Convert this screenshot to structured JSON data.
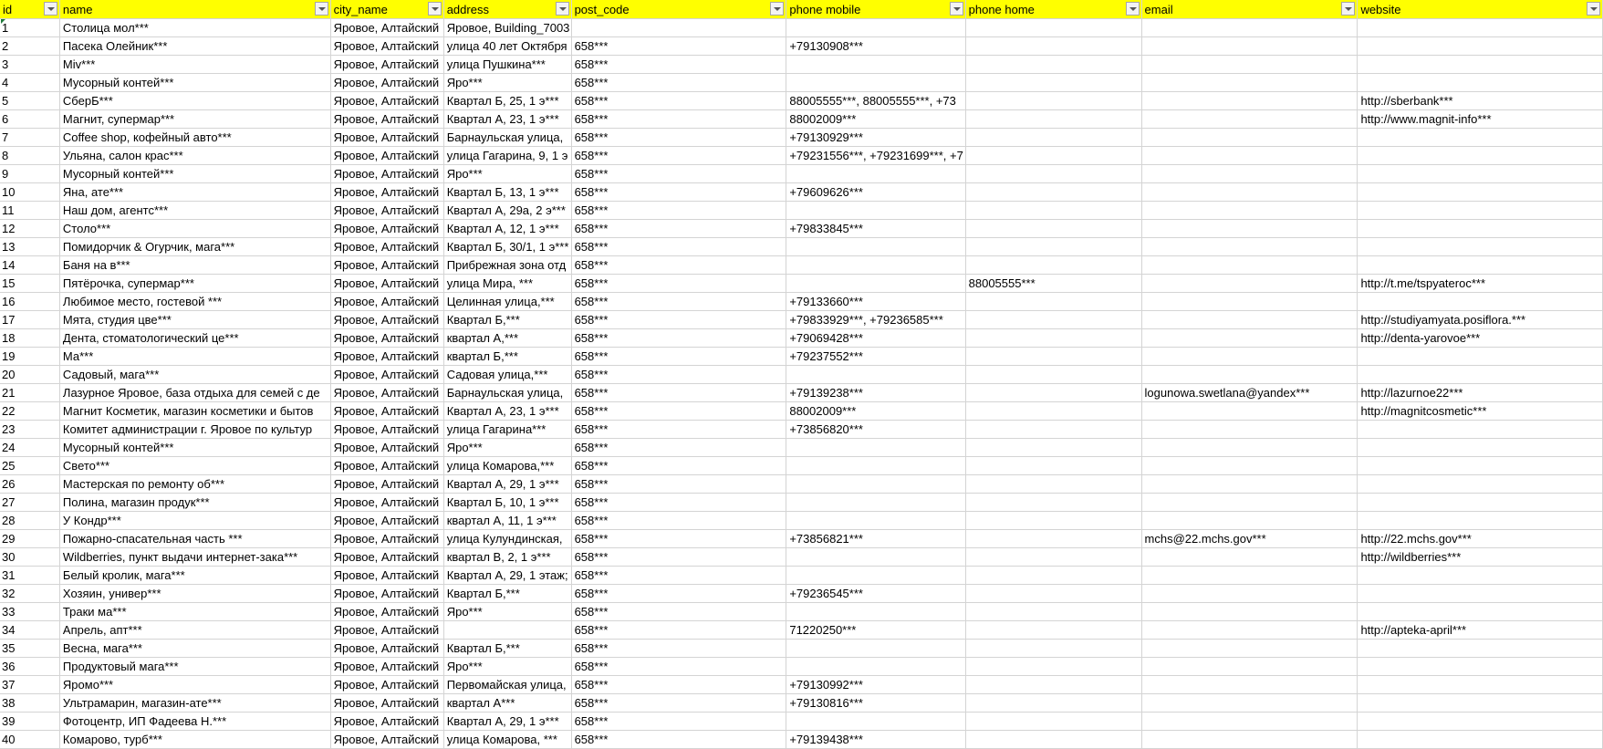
{
  "colors": {
    "header_bg": "#ffff00",
    "grid": "#d4d4d4",
    "active_marker": "#1f7a3a"
  },
  "columns": [
    "id",
    "name",
    "city_name",
    "address",
    "post_code",
    "phone mobile",
    "phone home",
    "email",
    "website"
  ],
  "rows": [
    [
      "1",
      "Столица мол***",
      "Яровое, Алтайский",
      "Яровое, Building_7003",
      "",
      "",
      "",
      "",
      ""
    ],
    [
      "2",
      "Пасека Олейник***",
      "Яровое, Алтайский",
      "улица 40 лет Октября",
      "658***",
      "+79130908***",
      "",
      "",
      ""
    ],
    [
      "3",
      "Miv***",
      "Яровое, Алтайский",
      "улица Пушкина***",
      "658***",
      "",
      "",
      "",
      ""
    ],
    [
      "4",
      "Мусорный контей***",
      "Яровое, Алтайский",
      "Яро***",
      "658***",
      "",
      "",
      "",
      ""
    ],
    [
      "5",
      "СберБ***",
      "Яровое, Алтайский",
      "Квартал Б, 25, 1 э***",
      "658***",
      "88005555***, 88005555***, +73",
      "",
      "",
      "http://sberbank***"
    ],
    [
      "6",
      "Магнит, супермар***",
      "Яровое, Алтайский",
      "Квартал А, 23, 1 э***",
      "658***",
      "88002009***",
      "",
      "",
      "http://www.magnit-info***"
    ],
    [
      "7",
      "Coffee shop, кофейный авто***",
      "Яровое, Алтайский",
      "Барнаульская улица,",
      "658***",
      "+79130929***",
      "",
      "",
      ""
    ],
    [
      "8",
      "Ульяна, салон крас***",
      "Яровое, Алтайский",
      "улица Гагарина, 9, 1 э",
      "658***",
      "+79231556***, +79231699***, +7",
      "",
      "",
      ""
    ],
    [
      "9",
      "Мусорный контей***",
      "Яровое, Алтайский",
      "Яро***",
      "658***",
      "",
      "",
      "",
      ""
    ],
    [
      "10",
      "Яна, ате***",
      "Яровое, Алтайский",
      "Квартал Б, 13, 1 э***",
      "658***",
      "+79609626***",
      "",
      "",
      ""
    ],
    [
      "11",
      "Наш дом, агентс***",
      "Яровое, Алтайский",
      "Квартал А, 29а, 2 э***",
      "658***",
      "",
      "",
      "",
      ""
    ],
    [
      "12",
      "Столо***",
      "Яровое, Алтайский",
      "Квартал А, 12, 1 э***",
      "658***",
      "+79833845***",
      "",
      "",
      ""
    ],
    [
      "13",
      "Помидорчик & Огурчик, мага***",
      "Яровое, Алтайский",
      "Квартал Б, 30/1, 1 э***",
      "658***",
      "",
      "",
      "",
      ""
    ],
    [
      "14",
      "Баня на в***",
      "Яровое, Алтайский",
      "Прибрежная зона отд",
      "658***",
      "",
      "",
      "",
      ""
    ],
    [
      "15",
      "Пятёрочка, супермар***",
      "Яровое, Алтайский",
      "улица Мира, ***",
      "658***",
      "",
      "88005555***",
      "",
      "http://t.me/tspyateroc***"
    ],
    [
      "16",
      "Любимое место, гостевой ***",
      "Яровое, Алтайский",
      "Целинная улица,***",
      "658***",
      "+79133660***",
      "",
      "",
      ""
    ],
    [
      "17",
      "Мята, студия цве***",
      "Яровое, Алтайский",
      "Квартал Б,***",
      "658***",
      "+79833929***, +79236585***",
      "",
      "",
      "http://studiyamyata.posiflora.***"
    ],
    [
      "18",
      "Дента, стоматологический це***",
      "Яровое, Алтайский",
      "квартал А,***",
      "658***",
      "+79069428***",
      "",
      "",
      "http://denta-yarovoe***"
    ],
    [
      "19",
      "Ма***",
      "Яровое, Алтайский",
      "квартал Б,***",
      "658***",
      "+79237552***",
      "",
      "",
      ""
    ],
    [
      "20",
      "Садовый, мага***",
      "Яровое, Алтайский",
      "Садовая улица,***",
      "658***",
      "",
      "",
      "",
      ""
    ],
    [
      "21",
      "Лазурное Яровое, база отдыха для семей с де",
      "Яровое, Алтайский",
      "Барнаульская улица,",
      "658***",
      "+79139238***",
      "",
      "logunowa.swetlana@yandex***",
      "http://lazurnoe22***"
    ],
    [
      "22",
      "Магнит Косметик, магазин косметики и бытов",
      "Яровое, Алтайский",
      "Квартал А, 23, 1 э***",
      "658***",
      "88002009***",
      "",
      "",
      "http://magnitcosmetic***"
    ],
    [
      "23",
      "Комитет администрации г. Яровое по культур",
      "Яровое, Алтайский",
      "улица Гагарина***",
      "658***",
      "+73856820***",
      "",
      "",
      ""
    ],
    [
      "24",
      "Мусорный контей***",
      "Яровое, Алтайский",
      "Яро***",
      "658***",
      "",
      "",
      "",
      ""
    ],
    [
      "25",
      "Свето***",
      "Яровое, Алтайский",
      "улица Комарова,***",
      "658***",
      "",
      "",
      "",
      ""
    ],
    [
      "26",
      "Мастерская по ремонту об***",
      "Яровое, Алтайский",
      "Квартал А, 29, 1 э***",
      "658***",
      "",
      "",
      "",
      ""
    ],
    [
      "27",
      "Полина, магазин продук***",
      "Яровое, Алтайский",
      "Квартал Б, 10, 1 э***",
      "658***",
      "",
      "",
      "",
      ""
    ],
    [
      "28",
      "У Кондр***",
      "Яровое, Алтайский",
      "квартал А, 11, 1 э***",
      "658***",
      "",
      "",
      "",
      ""
    ],
    [
      "29",
      "Пожарно-спасательная часть ***",
      "Яровое, Алтайский",
      "улица Кулундинская,",
      "658***",
      "+73856821***",
      "",
      "mchs@22.mchs.gov***",
      "http://22.mchs.gov***"
    ],
    [
      "30",
      "Wildberries, пункт выдачи интернет-зака***",
      "Яровое, Алтайский",
      "квартал В, 2, 1 э***",
      "658***",
      "",
      "",
      "",
      "http://wildberries***"
    ],
    [
      "31",
      "Белый кролик, мага***",
      "Яровое, Алтайский",
      "Квартал А, 29, 1 этаж;",
      "658***",
      "",
      "",
      "",
      ""
    ],
    [
      "32",
      "Хозяин, универ***",
      "Яровое, Алтайский",
      "Квартал Б,***",
      "658***",
      "+79236545***",
      "",
      "",
      ""
    ],
    [
      "33",
      "Траки ма***",
      "Яровое, Алтайский",
      "Яро***",
      "658***",
      "",
      "",
      "",
      ""
    ],
    [
      "34",
      "Апрель, апт***",
      "Яровое, Алтайский",
      "",
      "658***",
      "71220250***",
      "",
      "",
      "http://apteka-april***"
    ],
    [
      "35",
      "Весна, мага***",
      "Яровое, Алтайский",
      "Квартал Б,***",
      "658***",
      "",
      "",
      "",
      ""
    ],
    [
      "36",
      "Продуктовый мага***",
      "Яровое, Алтайский",
      "Яро***",
      "658***",
      "",
      "",
      "",
      ""
    ],
    [
      "37",
      "Яромо***",
      "Яровое, Алтайский",
      "Первомайская улица,",
      "658***",
      "+79130992***",
      "",
      "",
      ""
    ],
    [
      "38",
      "Ультрамарин, магазин-ате***",
      "Яровое, Алтайский",
      "квартал А***",
      "658***",
      "+79130816***",
      "",
      "",
      ""
    ],
    [
      "39",
      "Фотоцентр, ИП Фадеева Н.***",
      "Яровое, Алтайский",
      "Квартал А, 29, 1 э***",
      "658***",
      "",
      "",
      "",
      ""
    ],
    [
      "40",
      "Комарово, турб***",
      "Яровое, Алтайский",
      "улица Комарова, ***",
      "658***",
      "+79139438***",
      "",
      "",
      ""
    ]
  ]
}
